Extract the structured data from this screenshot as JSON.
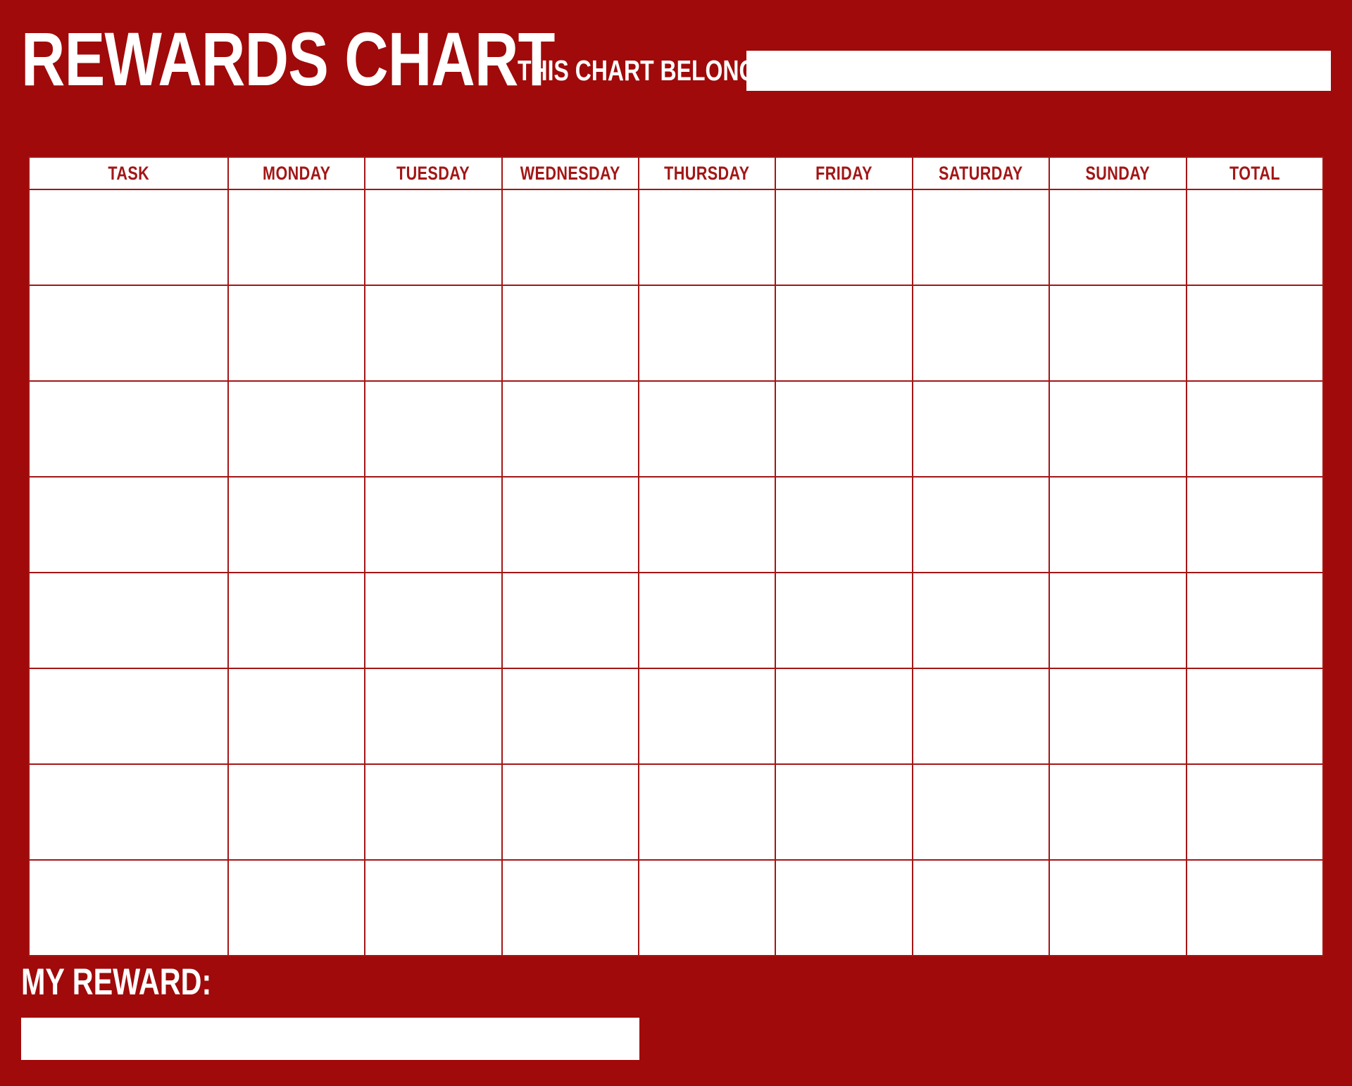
{
  "page": {
    "title": "REWARDS CHART",
    "background_color": "#a00a0a",
    "accent_color": "#a31616",
    "surface_color": "#ffffff"
  },
  "header": {
    "title": "REWARDS CHART",
    "belongs_to_label": "THIS CHART BELONGS TO:",
    "belongs_to_value": "",
    "belongs_to_placeholder": ""
  },
  "table": {
    "columns": [
      {
        "key": "task",
        "label": "TASK"
      },
      {
        "key": "monday",
        "label": "MONDAY"
      },
      {
        "key": "tuesday",
        "label": "TUESDAY"
      },
      {
        "key": "wednesday",
        "label": "WEDNESDAY"
      },
      {
        "key": "thursday",
        "label": "THURSDAY"
      },
      {
        "key": "friday",
        "label": "FRIDAY"
      },
      {
        "key": "saturday",
        "label": "SATURDAY"
      },
      {
        "key": "sunday",
        "label": "SUNDAY"
      },
      {
        "key": "total",
        "label": "TOTAL"
      }
    ],
    "row_count": 8,
    "rows": [
      {
        "task": "",
        "monday": "",
        "tuesday": "",
        "wednesday": "",
        "thursday": "",
        "friday": "",
        "saturday": "",
        "sunday": "",
        "total": ""
      },
      {
        "task": "",
        "monday": "",
        "tuesday": "",
        "wednesday": "",
        "thursday": "",
        "friday": "",
        "saturday": "",
        "sunday": "",
        "total": ""
      },
      {
        "task": "",
        "monday": "",
        "tuesday": "",
        "wednesday": "",
        "thursday": "",
        "friday": "",
        "saturday": "",
        "sunday": "",
        "total": ""
      },
      {
        "task": "",
        "monday": "",
        "tuesday": "",
        "wednesday": "",
        "thursday": "",
        "friday": "",
        "saturday": "",
        "sunday": "",
        "total": ""
      },
      {
        "task": "",
        "monday": "",
        "tuesday": "",
        "wednesday": "",
        "thursday": "",
        "friday": "",
        "saturday": "",
        "sunday": "",
        "total": ""
      },
      {
        "task": "",
        "monday": "",
        "tuesday": "",
        "wednesday": "",
        "thursday": "",
        "friday": "",
        "saturday": "",
        "sunday": "",
        "total": ""
      },
      {
        "task": "",
        "monday": "",
        "tuesday": "",
        "wednesday": "",
        "thursday": "",
        "friday": "",
        "saturday": "",
        "sunday": "",
        "total": ""
      },
      {
        "task": "",
        "monday": "",
        "tuesday": "",
        "wednesday": "",
        "thursday": "",
        "friday": "",
        "saturday": "",
        "sunday": "",
        "total": ""
      }
    ]
  },
  "footer": {
    "reward_label": "MY REWARD:",
    "reward_value": "",
    "reward_placeholder": ""
  }
}
